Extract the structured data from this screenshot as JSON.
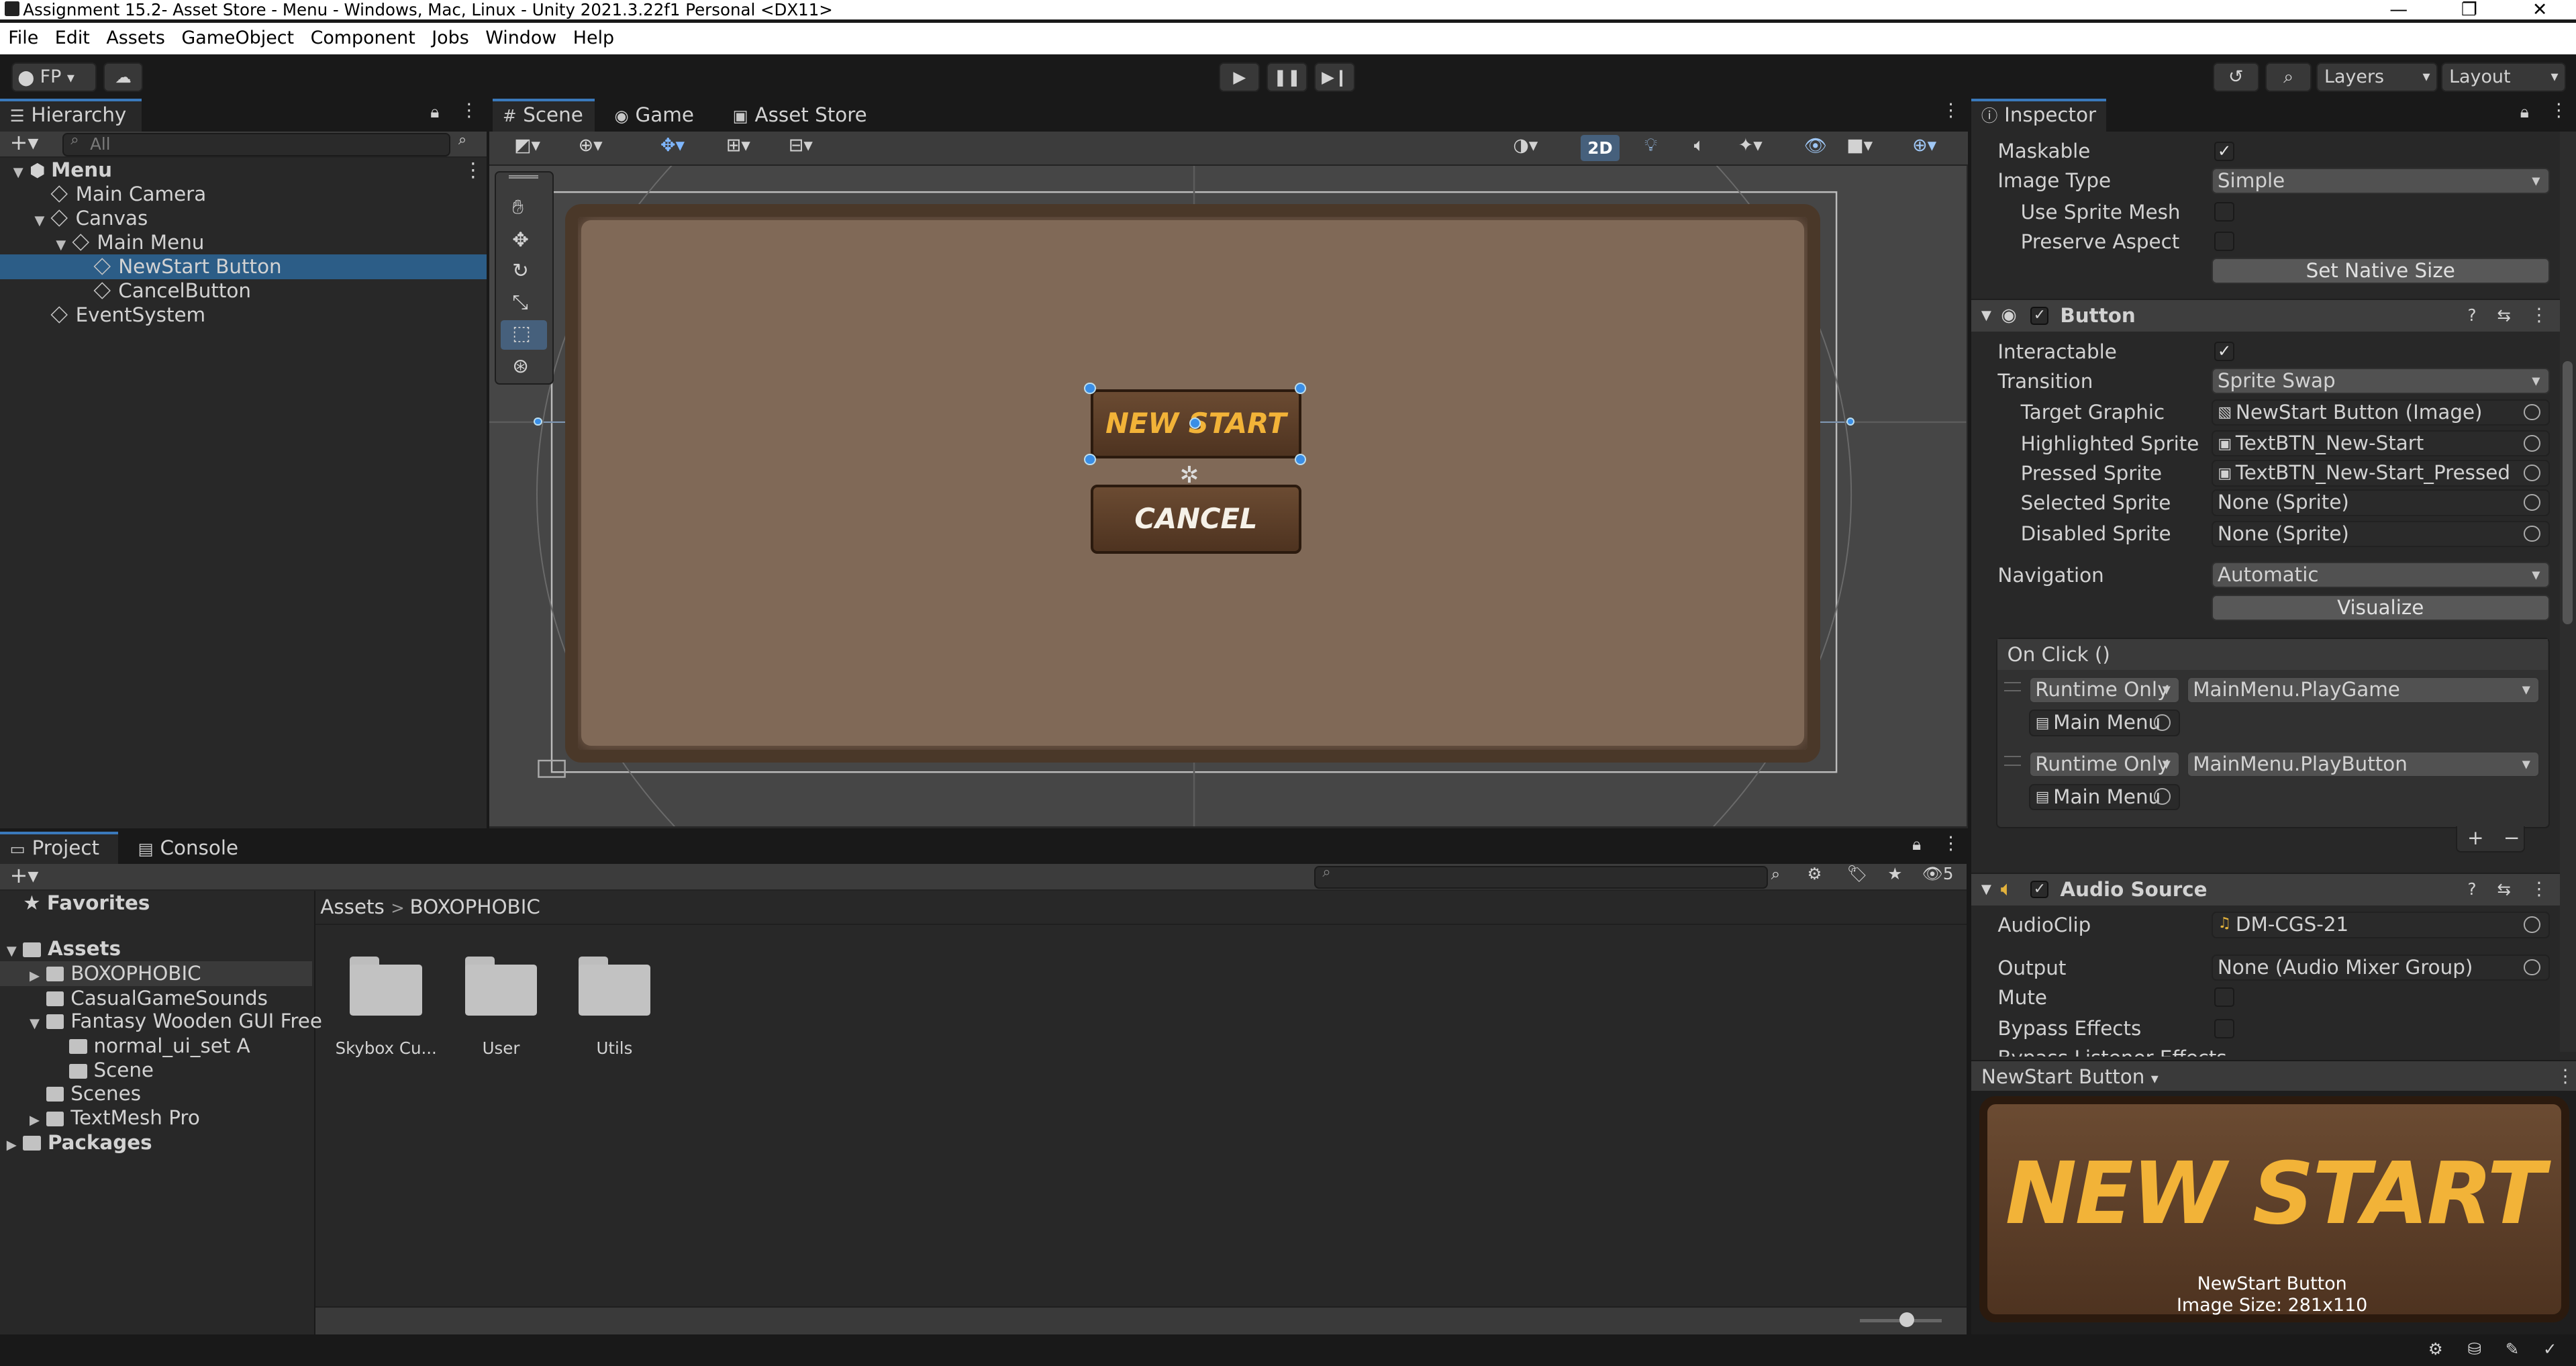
{
  "window": {
    "title": "Assignment 15.2- Asset Store - Menu - Windows, Mac, Linux - Unity 2021.3.22f1 Personal <DX11>",
    "controls": [
      "—",
      "❐",
      "✕"
    ]
  },
  "menu": [
    "File",
    "Edit",
    "Assets",
    "GameObject",
    "Component",
    "Jobs",
    "Window",
    "Help"
  ],
  "toolbar": {
    "account": "FP",
    "layers_label": "Layers",
    "layout_label": "Layout"
  },
  "hierarchy": {
    "tab": "Hierarchy",
    "search_placeholder": "All",
    "items": [
      {
        "label": "Menu",
        "depth": 0,
        "expanded": true,
        "scene": true,
        "selected": false
      },
      {
        "label": "Main Camera",
        "depth": 1,
        "expanded": null,
        "scene": false,
        "selected": false
      },
      {
        "label": "Canvas",
        "depth": 1,
        "expanded": true,
        "scene": false,
        "selected": false
      },
      {
        "label": "Main Menu",
        "depth": 2,
        "expanded": true,
        "scene": false,
        "selected": false
      },
      {
        "label": "NewStart Button",
        "depth": 3,
        "expanded": null,
        "scene": false,
        "selected": true
      },
      {
        "label": "CancelButton",
        "depth": 3,
        "expanded": null,
        "scene": false,
        "selected": false
      },
      {
        "label": "EventSystem",
        "depth": 1,
        "expanded": null,
        "scene": false,
        "selected": false
      }
    ]
  },
  "scene_tabs": [
    "Scene",
    "Game",
    "Asset Store"
  ],
  "scene": {
    "mode_2d": "2D",
    "buttons": {
      "new_start": "NEW START",
      "cancel": "CANCEL"
    }
  },
  "project": {
    "tabs": [
      "Project",
      "Console"
    ],
    "breadcrumb": [
      "Assets",
      "BOXOPHOBIC"
    ],
    "hidden_count": "5",
    "tree": [
      {
        "label": "Favorites",
        "type": "star",
        "bold": true
      },
      {
        "label": "Assets",
        "type": "folder-open",
        "bold": true
      },
      {
        "label": "BOXOPHOBIC",
        "type": "folder",
        "bold": false
      },
      {
        "label": "CasualGameSounds",
        "type": "folder",
        "bold": false
      },
      {
        "label": "Fantasy Wooden GUI  Free",
        "type": "folder-open",
        "bold": false
      },
      {
        "label": "normal_ui_set A",
        "type": "folder",
        "bold": false
      },
      {
        "label": "Scene",
        "type": "folder",
        "bold": false
      },
      {
        "label": "Scenes",
        "type": "folder",
        "bold": false
      },
      {
        "label": "TextMesh Pro",
        "type": "folder",
        "bold": false
      },
      {
        "label": "Packages",
        "type": "folder",
        "bold": true
      }
    ],
    "folders": [
      "Skybox Cu...",
      "User",
      "Utils"
    ]
  },
  "inspector": {
    "tab": "Inspector",
    "image": {
      "maskable": "Maskable",
      "image_type_label": "Image Type",
      "image_type_value": "Simple",
      "use_sprite_mesh": "Use Sprite Mesh",
      "preserve_aspect": "Preserve Aspect",
      "set_native_size": "Set Native Size"
    },
    "button": {
      "header": "Button",
      "interactable": "Interactable",
      "transition_label": "Transition",
      "transition_value": "Sprite Swap",
      "target_graphic_label": "Target Graphic",
      "target_graphic_value": "NewStart Button (Image)",
      "highlighted_label": "Highlighted Sprite",
      "highlighted_value": "TextBTN_New-Start",
      "pressed_label": "Pressed Sprite",
      "pressed_value": "TextBTN_New-Start_Pressed",
      "selected_label": "Selected Sprite",
      "selected_value": "None (Sprite)",
      "disabled_label": "Disabled Sprite",
      "disabled_value": "None (Sprite)",
      "navigation_label": "Navigation",
      "navigation_value": "Automatic",
      "visualize": "Visualize",
      "onclick_header": "On Click ()",
      "events": [
        {
          "mode": "Runtime Only",
          "function": "MainMenu.PlayGame",
          "object": "Main Menu"
        },
        {
          "mode": "Runtime Only",
          "function": "MainMenu.PlayButton",
          "object": "Main Menu"
        }
      ],
      "add": "+",
      "remove": "−"
    },
    "audio": {
      "header": "Audio Source",
      "clip_label": "AudioClip",
      "clip_value": "DM-CGS-21",
      "output_label": "Output",
      "output_value": "None (Audio Mixer Group)",
      "mute": "Mute",
      "bypass_effects": "Bypass Effects",
      "bypass_listener": "Bypass Listener Effects"
    },
    "preview": {
      "title": "NewStart Button",
      "image_text": "NEW START",
      "caption_name": "NewStart Button",
      "caption_size": "Image Size: 281x110"
    }
  }
}
